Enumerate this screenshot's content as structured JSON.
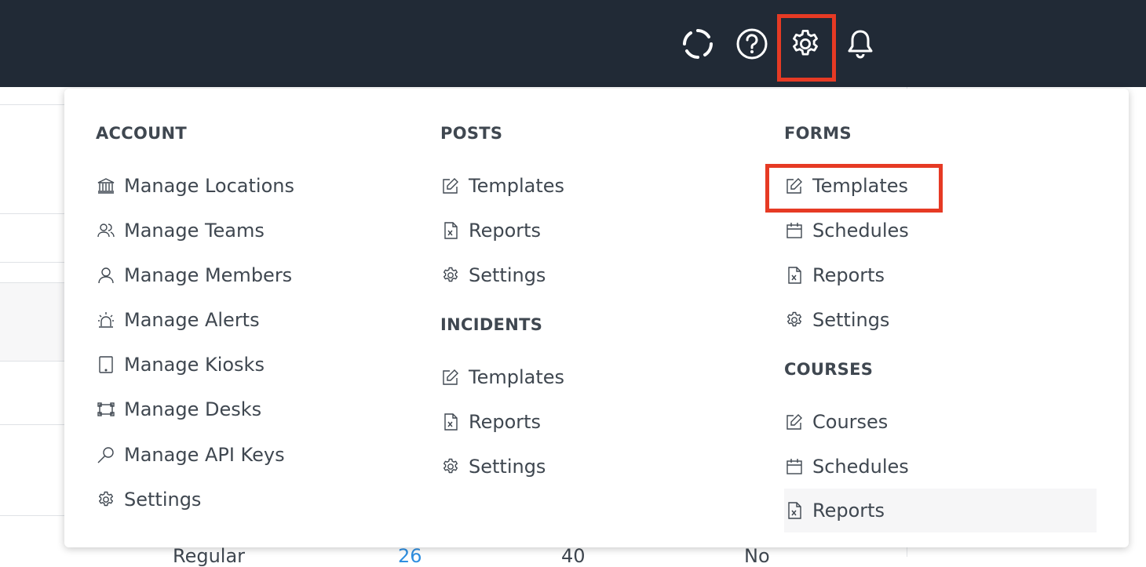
{
  "topbar": {
    "icons": [
      "loading-ring-icon",
      "help-icon",
      "gear-icon",
      "bell-icon"
    ]
  },
  "background": {
    "row_text": [
      "Regular",
      "26",
      "40",
      "No"
    ]
  },
  "menu": {
    "account": {
      "title": "ACCOUNT",
      "items": [
        {
          "label": "Manage Locations",
          "icon": "bank-icon"
        },
        {
          "label": "Manage Teams",
          "icon": "team-icon"
        },
        {
          "label": "Manage Members",
          "icon": "person-icon"
        },
        {
          "label": "Manage Alerts",
          "icon": "alarm-icon"
        },
        {
          "label": "Manage Kiosks",
          "icon": "tablet-icon"
        },
        {
          "label": "Manage Desks",
          "icon": "desk-icon"
        },
        {
          "label": "Manage API Keys",
          "icon": "key-icon"
        },
        {
          "label": "Settings",
          "icon": "gear-icon"
        }
      ]
    },
    "posts": {
      "title": "POSTS",
      "items": [
        {
          "label": "Templates",
          "icon": "edit-icon"
        },
        {
          "label": "Reports",
          "icon": "excel-file-icon"
        },
        {
          "label": "Settings",
          "icon": "gear-icon"
        }
      ]
    },
    "incidents": {
      "title": "INCIDENTS",
      "items": [
        {
          "label": "Templates",
          "icon": "edit-icon"
        },
        {
          "label": "Reports",
          "icon": "excel-file-icon"
        },
        {
          "label": "Settings",
          "icon": "gear-icon"
        }
      ]
    },
    "forms": {
      "title": "FORMS",
      "items": [
        {
          "label": "Templates",
          "icon": "edit-icon"
        },
        {
          "label": "Schedules",
          "icon": "calendar-icon"
        },
        {
          "label": "Reports",
          "icon": "excel-file-icon"
        },
        {
          "label": "Settings",
          "icon": "gear-icon"
        }
      ]
    },
    "courses": {
      "title": "COURSES",
      "items": [
        {
          "label": "Courses",
          "icon": "edit-icon"
        },
        {
          "label": "Schedules",
          "icon": "calendar-icon"
        },
        {
          "label": "Reports",
          "icon": "excel-file-icon"
        }
      ]
    }
  },
  "colors": {
    "topbar": "#212a36",
    "highlight": "#e63a24",
    "text": "#3f4750",
    "link": "#2f8fe0"
  }
}
